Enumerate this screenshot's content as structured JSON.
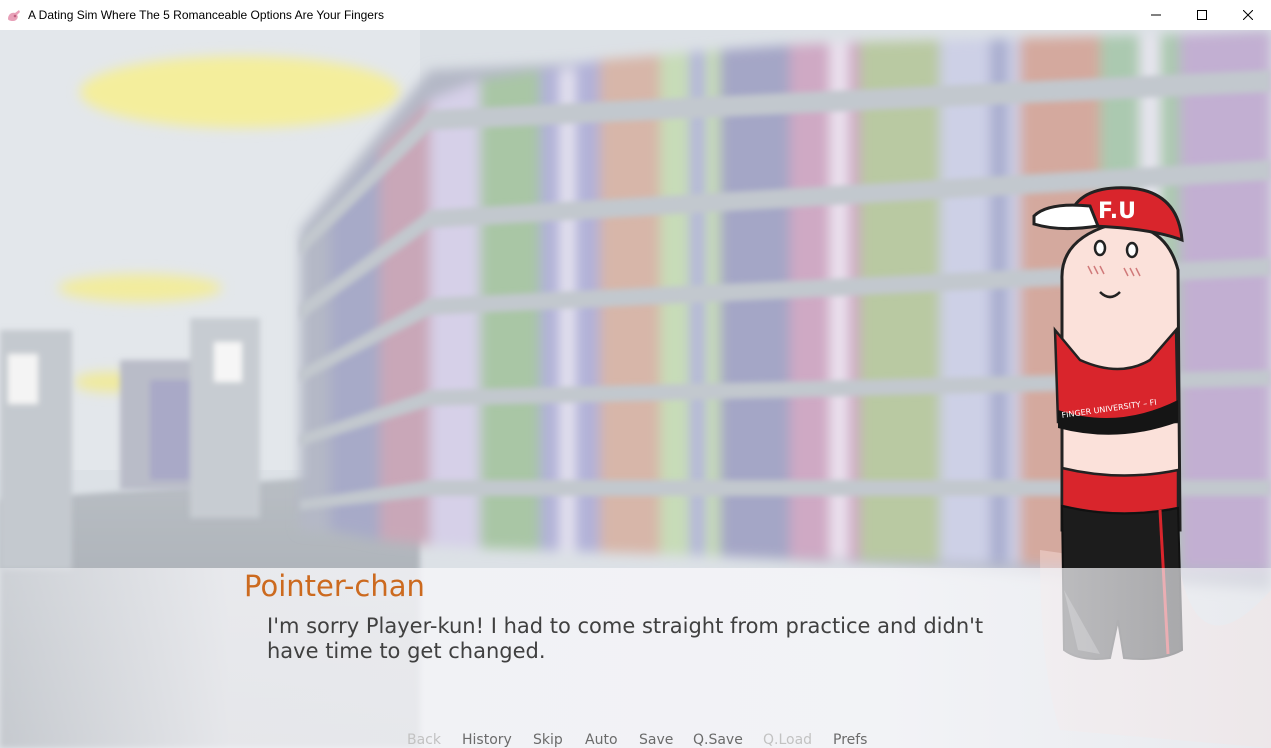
{
  "window": {
    "title": "A Dating Sim Where The 5 Romanceable Options Are Your Fingers",
    "controls": [
      "minimize-icon",
      "maximize-icon",
      "close-icon"
    ]
  },
  "character": {
    "cap_text": "F.U",
    "band_text": "FINGER UNIVERSITY – FI"
  },
  "dialogue": {
    "speaker": "Pointer-chan",
    "speaker_color": "#cc6a1f",
    "text": "I'm sorry Player-kun! I had to come straight from practice and didn't have time to get changed."
  },
  "quick_menu": [
    {
      "label": "Back",
      "enabled": false
    },
    {
      "label": "History",
      "enabled": true
    },
    {
      "label": "Skip",
      "enabled": true
    },
    {
      "label": "Auto",
      "enabled": true
    },
    {
      "label": "Save",
      "enabled": true
    },
    {
      "label": "Q.Save",
      "enabled": true
    },
    {
      "label": "Q.Load",
      "enabled": false
    },
    {
      "label": "Prefs",
      "enabled": true
    }
  ]
}
